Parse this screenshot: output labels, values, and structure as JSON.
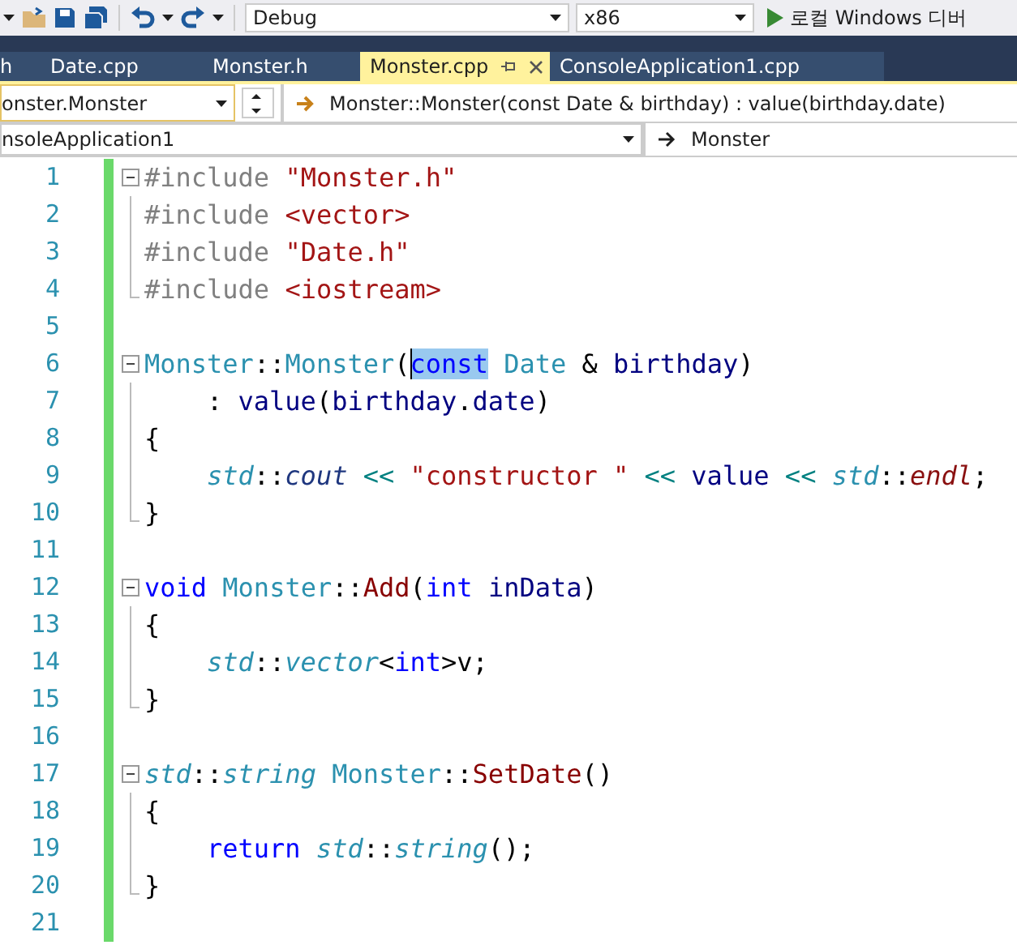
{
  "toolbar": {
    "configuration": "Debug",
    "platform": "x86",
    "run_label": "로컬 Windows 디버"
  },
  "tabs": [
    {
      "label": "h",
      "selected": false
    },
    {
      "label": "Date.cpp",
      "selected": false
    },
    {
      "label": "Monster.h",
      "selected": false
    },
    {
      "label": "Monster.cpp",
      "selected": true
    },
    {
      "label": "ConsoleApplication1.cpp",
      "selected": false
    }
  ],
  "navigation": {
    "scope": "onster.Monster",
    "member": "Monster::Monster(const Date & birthday) : value(birthday.date)",
    "project": "nsoleApplication1",
    "type": "Monster"
  },
  "code_lines": [
    {
      "number": "1",
      "kind": "opener",
      "tokens": [
        {
          "kind": "pre",
          "text": "#include "
        },
        {
          "kind": "str",
          "text": "\"Monster.h\""
        }
      ]
    },
    {
      "number": "2",
      "kind": "inner",
      "tokens": [
        {
          "kind": "pre",
          "text": "#include "
        },
        {
          "kind": "str",
          "text": "<vector>"
        }
      ]
    },
    {
      "number": "3",
      "kind": "inner",
      "tokens": [
        {
          "kind": "pre",
          "text": "#include "
        },
        {
          "kind": "str",
          "text": "\"Date.h\""
        }
      ]
    },
    {
      "number": "4",
      "kind": "closer",
      "tokens": [
        {
          "kind": "pre",
          "text": "#include "
        },
        {
          "kind": "str",
          "text": "<iostream>"
        }
      ]
    },
    {
      "number": "5",
      "kind": "blank"
    },
    {
      "number": "6",
      "kind": "opener",
      "tokens": [
        {
          "kind": "type",
          "text": "Monster"
        },
        {
          "kind": "plain",
          "text": "::"
        },
        {
          "kind": "type",
          "text": "Monster"
        },
        {
          "kind": "plain",
          "text": "("
        },
        {
          "kind": "kw",
          "text": "const",
          "selected": true
        },
        {
          "kind": "type",
          "text": " Date"
        },
        {
          "kind": "plain",
          "text": " & "
        },
        {
          "kind": "param",
          "text": "birthday"
        },
        {
          "kind": "plain",
          "text": ")"
        }
      ]
    },
    {
      "number": "7",
      "kind": "inner",
      "indented": true,
      "tokens": [
        {
          "kind": "plain",
          "text": ": "
        },
        {
          "kind": "field",
          "text": "value"
        },
        {
          "kind": "plain",
          "text": "("
        },
        {
          "kind": "param",
          "text": "birthday"
        },
        {
          "kind": "plain",
          "text": "."
        },
        {
          "kind": "field",
          "text": "date"
        },
        {
          "kind": "plain",
          "text": ")"
        }
      ]
    },
    {
      "number": "8",
      "kind": "inner",
      "tokens": [
        {
          "kind": "plain",
          "text": "{"
        }
      ]
    },
    {
      "number": "9",
      "kind": "inner",
      "indented": true,
      "tokens": [
        {
          "kind": "ns",
          "text": "std"
        },
        {
          "kind": "plain",
          "text": "::"
        },
        {
          "kind": "global",
          "text": "cout"
        },
        {
          "kind": "op",
          "text": " << "
        },
        {
          "kind": "str",
          "text": "\"constructor \""
        },
        {
          "kind": "op",
          "text": " << "
        },
        {
          "kind": "field",
          "text": "value"
        },
        {
          "kind": "op",
          "text": " << "
        },
        {
          "kind": "ns",
          "text": "std"
        },
        {
          "kind": "plain",
          "text": "::"
        },
        {
          "kind": "fnit",
          "text": "endl"
        },
        {
          "kind": "plain",
          "text": ";"
        }
      ]
    },
    {
      "number": "10",
      "kind": "closer",
      "tokens": [
        {
          "kind": "plain",
          "text": "}"
        }
      ]
    },
    {
      "number": "11",
      "kind": "blank"
    },
    {
      "number": "12",
      "kind": "opener",
      "tokens": [
        {
          "kind": "kw",
          "text": "void"
        },
        {
          "kind": "type",
          "text": " Monster"
        },
        {
          "kind": "plain",
          "text": "::"
        },
        {
          "kind": "fn",
          "text": "Add"
        },
        {
          "kind": "plain",
          "text": "("
        },
        {
          "kind": "kw",
          "text": "int"
        },
        {
          "kind": "param",
          "text": " inData"
        },
        {
          "kind": "plain",
          "text": ")"
        }
      ]
    },
    {
      "number": "13",
      "kind": "inner",
      "tokens": [
        {
          "kind": "plain",
          "text": "{"
        }
      ]
    },
    {
      "number": "14",
      "kind": "inner",
      "indented": true,
      "tokens": [
        {
          "kind": "ns",
          "text": "std"
        },
        {
          "kind": "plain",
          "text": "::"
        },
        {
          "kind": "ns",
          "text": "vector"
        },
        {
          "kind": "plain",
          "text": "<"
        },
        {
          "kind": "kw",
          "text": "int"
        },
        {
          "kind": "plain",
          "text": ">v;"
        }
      ]
    },
    {
      "number": "15",
      "kind": "closer",
      "tokens": [
        {
          "kind": "plain",
          "text": "}"
        }
      ]
    },
    {
      "number": "16",
      "kind": "blank"
    },
    {
      "number": "17",
      "kind": "opener",
      "tokens": [
        {
          "kind": "ns",
          "text": "std"
        },
        {
          "kind": "plain",
          "text": "::"
        },
        {
          "kind": "ns",
          "text": "string"
        },
        {
          "kind": "type",
          "text": " Monster"
        },
        {
          "kind": "plain",
          "text": "::"
        },
        {
          "kind": "fn",
          "text": "SetDate"
        },
        {
          "kind": "plain",
          "text": "()"
        }
      ]
    },
    {
      "number": "18",
      "kind": "inner",
      "tokens": [
        {
          "kind": "plain",
          "text": "{"
        }
      ]
    },
    {
      "number": "19",
      "kind": "inner",
      "indented": true,
      "tokens": [
        {
          "kind": "kw",
          "text": "return"
        },
        {
          "kind": "ns",
          "text": " std"
        },
        {
          "kind": "plain",
          "text": "::"
        },
        {
          "kind": "ns",
          "text": "string"
        },
        {
          "kind": "plain",
          "text": "();"
        }
      ]
    },
    {
      "number": "20",
      "kind": "closer",
      "tokens": [
        {
          "kind": "plain",
          "text": "}"
        }
      ]
    },
    {
      "number": "21",
      "kind": "blank"
    }
  ]
}
